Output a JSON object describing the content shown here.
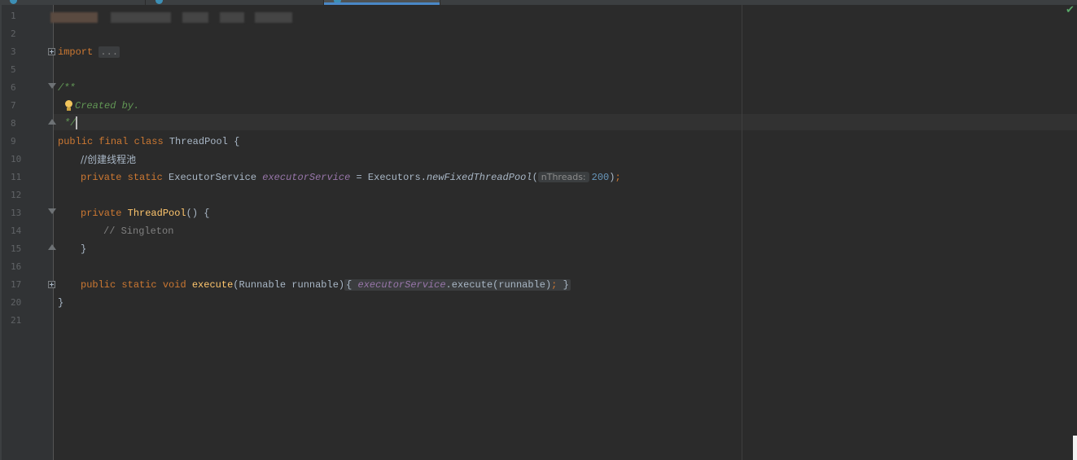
{
  "tabs": [
    {
      "name": "tab-1",
      "label": ""
    },
    {
      "name": "tab-2",
      "label": ""
    },
    {
      "name": "tab-3",
      "label": "",
      "active": true
    }
  ],
  "editor": {
    "line_numbers": [
      "1",
      "2",
      "3",
      "5",
      "6",
      "7",
      "8",
      "9",
      "10",
      "11",
      "12",
      "13",
      "14",
      "15",
      "16",
      "17",
      "20",
      "21"
    ],
    "import_keyword": "import",
    "import_folded": "...",
    "doc_open": "/**",
    "doc_created": "Created by.",
    "doc_close": "*/",
    "class_public": "public",
    "class_final": "final",
    "class_kw": "class",
    "class_name": "ThreadPool",
    "class_open": " {",
    "comment_pool": "//创建线程池",
    "field_private": "private",
    "field_static": "static",
    "field_type": "ExecutorService",
    "field_name": "executorService",
    "field_assign": " = Executors.",
    "field_call": "newFixedThreadPool",
    "paren_open": "(",
    "param_hint": "nThreads:",
    "param_value": "200",
    "paren_close": ")",
    "semicolon": ";",
    "ctor_private": "private",
    "ctor_name": "ThreadPool",
    "ctor_sig": "() {",
    "comment_singleton": "// Singleton",
    "close_brace": "}",
    "exec_public": "public",
    "exec_static": "static",
    "exec_void": "void",
    "exec_name": "execute",
    "exec_params": "(Runnable runnable)",
    "exec_body_open": "{",
    "exec_body_field": "executorService",
    "exec_body_call": ".execute(runnable)",
    "exec_body_semi": ";",
    "exec_body_close": "}",
    "class_close": "}"
  },
  "status": {
    "check_icon": "check-icon",
    "check_glyph": "✔",
    "check_color": "#59a869"
  }
}
